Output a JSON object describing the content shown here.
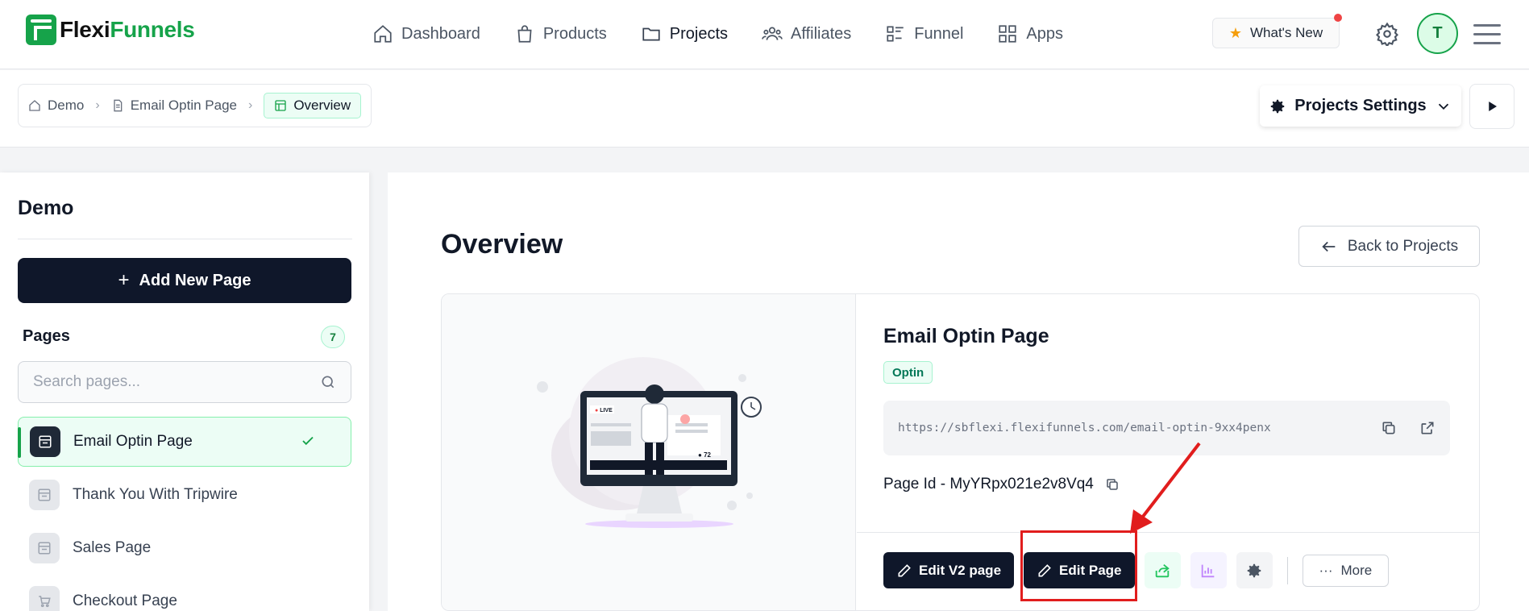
{
  "brand": {
    "name_part1": "Flexi",
    "name_part2": "Funnels"
  },
  "nav": {
    "items": [
      {
        "label": "Dashboard",
        "icon": "home-icon"
      },
      {
        "label": "Products",
        "icon": "shopping-bag-icon"
      },
      {
        "label": "Projects",
        "icon": "folder-icon"
      },
      {
        "label": "Affiliates",
        "icon": "users-icon"
      },
      {
        "label": "Funnel",
        "icon": "funnel-icon"
      },
      {
        "label": "Apps",
        "icon": "grid-icon"
      }
    ],
    "whats_new": "What's New",
    "avatar_initial": "T"
  },
  "breadcrumb": {
    "items": [
      "Demo",
      "Email Optin Page",
      "Overview"
    ]
  },
  "header_actions": {
    "settings_label": "Projects Settings"
  },
  "sidebar": {
    "project_title": "Demo",
    "add_page_label": "Add New Page",
    "pages_label": "Pages",
    "pages_count": "7",
    "search_placeholder": "Search pages...",
    "pages": [
      {
        "name": "Email Optin Page",
        "active": true
      },
      {
        "name": "Thank You With Tripwire",
        "active": false
      },
      {
        "name": "Sales Page",
        "active": false
      },
      {
        "name": "Checkout Page",
        "active": false
      }
    ]
  },
  "main": {
    "title": "Overview",
    "back_label": "Back to Projects",
    "page": {
      "name": "Email Optin Page",
      "type": "Optin",
      "url": "https://sbflexi.flexifunnels.com/email-optin-9xx4penx",
      "page_id": "Page Id - MyYRpx021e2v8Vq4"
    },
    "actions": {
      "edit_v2": "Edit V2 page",
      "edit": "Edit Page",
      "more": "More"
    },
    "illustration": {
      "live_label": "LIVE",
      "viewers": "72"
    }
  },
  "colors": {
    "brand_green": "#16a34a",
    "dark": "#0f172a",
    "annotation_red": "#e11d1d"
  }
}
